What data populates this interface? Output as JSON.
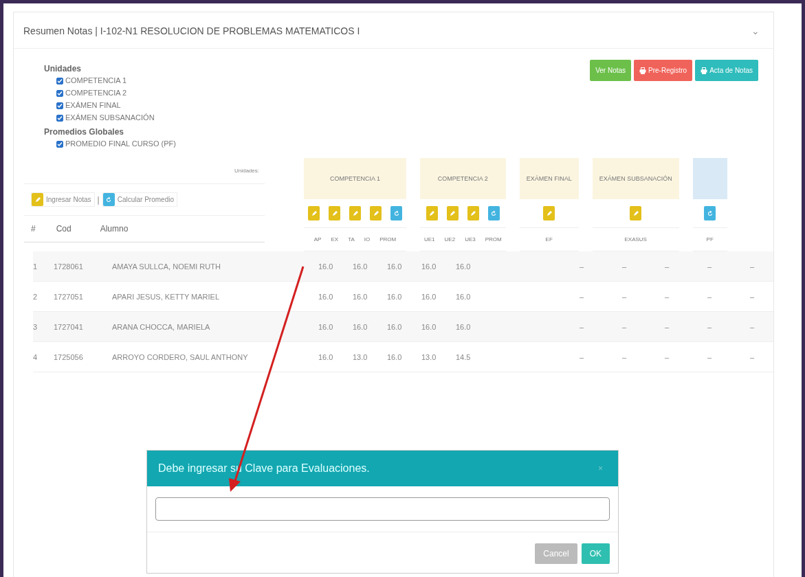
{
  "panel": {
    "title": "Resumen Notas | I-102-N1 RESOLUCION DE PROBLEMAS MATEMATICOS I",
    "collapse_icon": "⌄"
  },
  "filters": [
    {
      "heading": "Unidades",
      "items": [
        {
          "label": "COMPETENCIA 1",
          "checked": true
        },
        {
          "label": "COMPETENCIA 2",
          "checked": true
        },
        {
          "label": "EXÁMEN FINAL",
          "checked": true
        },
        {
          "label": "EXÁMEN SUBSANACIÓN",
          "checked": true
        }
      ]
    },
    {
      "heading": "Promedios Globales",
      "items": [
        {
          "label": "PROMEDIO FINAL CURSO (PF)",
          "checked": true
        }
      ]
    }
  ],
  "actions": [
    {
      "label": "Ver Notas",
      "kind": "success",
      "icon": false
    },
    {
      "label": "Pre-Registro",
      "kind": "danger",
      "icon": true
    },
    {
      "label": "Acta de Notas",
      "kind": "info",
      "icon": true
    }
  ],
  "table": {
    "units_label": "Unidades:",
    "tools": [
      {
        "label": "Ingresar Notas",
        "kind": "edit"
      },
      {
        "label": "Calcular Promedio",
        "kind": "calc"
      }
    ],
    "tool_separator": "|",
    "columns": [
      "#",
      "Cod",
      "Alumno"
    ],
    "groups": [
      {
        "title": "COMPETENCIA 1",
        "kind": "unit",
        "buttons": [
          {
            "kind": "edit"
          },
          {
            "kind": "edit"
          },
          {
            "kind": "edit"
          },
          {
            "kind": "edit"
          },
          {
            "kind": "calc"
          }
        ],
        "columns": [
          "AP",
          "EX",
          "TA",
          "IO",
          "PROM"
        ]
      },
      {
        "title": "COMPETENCIA 2",
        "kind": "unit",
        "buttons": [
          {
            "kind": "edit"
          },
          {
            "kind": "edit"
          },
          {
            "kind": "edit"
          },
          {
            "kind": "calc"
          }
        ],
        "columns": [
          "UE1",
          "UE2",
          "UE3",
          "PROM"
        ]
      },
      {
        "title": "EXÁMEN FINAL",
        "kind": "unit",
        "buttons": [
          {
            "kind": "edit"
          }
        ],
        "columns": [
          "EF"
        ]
      },
      {
        "title": "EXÁMEN SUBSANACIÓN",
        "kind": "unit",
        "buttons": [
          {
            "kind": "edit"
          }
        ],
        "columns": [
          "EXASUS"
        ]
      },
      {
        "kind": "average",
        "buttons": [
          {
            "kind": "calc"
          }
        ],
        "columns": [
          "PF"
        ]
      }
    ],
    "rows": [
      {
        "num": "1",
        "cod": "1728061",
        "name": "AMAYA SULLCA, NOEMI RUTH",
        "grades": [
          "16.0",
          "16.0",
          "16.0",
          "16.0",
          "16.0"
        ],
        "rest": [
          "–",
          "–",
          "–",
          "–",
          "–"
        ]
      },
      {
        "num": "2",
        "cod": "1727051",
        "name": "APARI JESUS, KETTY MARIEL",
        "grades": [
          "16.0",
          "16.0",
          "16.0",
          "16.0",
          "16.0"
        ],
        "rest": [
          "–",
          "–",
          "–",
          "–",
          "–"
        ]
      },
      {
        "num": "3",
        "cod": "1727041",
        "name": "ARANA CHOCCA, MARIELA",
        "grades": [
          "16.0",
          "16.0",
          "16.0",
          "16.0",
          "16.0"
        ],
        "rest": [
          "–",
          "–",
          "–",
          "–",
          "–"
        ]
      },
      {
        "num": "4",
        "cod": "1725056",
        "name": "ARROYO CORDERO, SAUL ANTHONY",
        "grades": [
          "16.0",
          "13.0",
          "16.0",
          "13.0",
          "14.5"
        ],
        "rest": [
          "–",
          "–",
          "–",
          "–",
          "–"
        ]
      }
    ]
  },
  "dialog": {
    "title": "Debe ingresar su Clave para Evaluaciones.",
    "close": "×",
    "buttons": [
      {
        "label": "Cancel",
        "kind": "cancel"
      },
      {
        "label": "OK",
        "kind": "ok"
      }
    ]
  }
}
